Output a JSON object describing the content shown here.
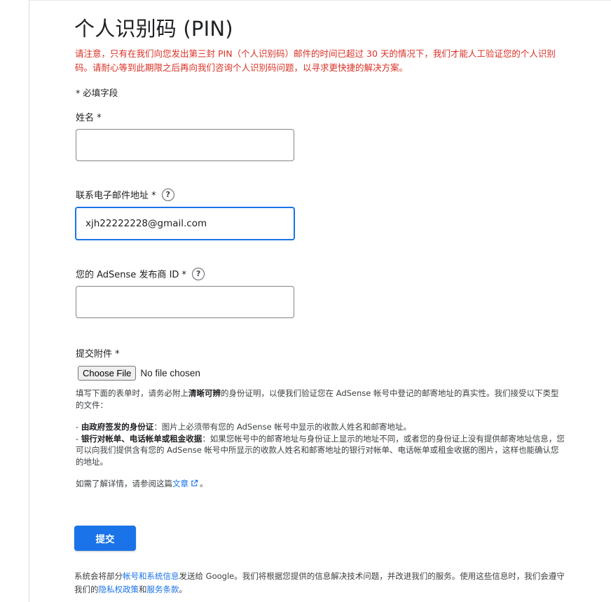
{
  "title": "个人识别码 (PIN)",
  "notice": "请注意，只有在我们向您发出第三封 PIN（个人识别码）邮件的时间已超过 30 天的情况下，我们才能人工验证您的个人识别码。请耐心等到此期限之后再向我们咨询个人识别码问题，以寻求更快捷的解决方案。",
  "required_note": "* 必填字段",
  "fields": {
    "name": {
      "label": "姓名 *",
      "value": ""
    },
    "email": {
      "label": "联系电子邮件地址 *",
      "value": "xjh22222228@gmail.com",
      "help_icon": "help-circle-icon"
    },
    "publisher_id": {
      "label": "您的 AdSense 发布商 ID *",
      "value": "",
      "help_icon": "help-circle-icon"
    },
    "attachment": {
      "label": "提交附件 *",
      "button": "Choose File",
      "status": "No file chosen"
    }
  },
  "helptext": {
    "intro_a": "填写下面的表单时，请务必附上",
    "intro_bold": "清晰可辨",
    "intro_b": "的身份证明，以便我们验证您在 AdSense 帐号中登记的邮寄地址的真实性。我们接受以下类型的文件：",
    "item1_prefix": "- ",
    "item1_bold": "由政府签发的身份证",
    "item1_text": "：图片上必须带有您的 AdSense 帐号中显示的收款人姓名和邮寄地址。",
    "item2_prefix": "- ",
    "item2_bold": "银行对帐单、电话帐单或租金收据",
    "item2_text": "：如果您帐号中的邮寄地址与身份证上显示的地址不同，或者您的身份证上没有提供邮寄地址信息，您可以向我们提供含有您的 AdSense 帐号中所显示的收款人姓名和邮寄地址的银行对帐单、电话帐单或租金收据的图片，这样也能确认您的地址。",
    "more_prefix": "如需了解详情，请参阅这篇",
    "more_link": "文章",
    "more_suffix": "。",
    "link_icon": "external-link-icon"
  },
  "submit_label": "提交",
  "footer": {
    "part1": "系统会将部分",
    "link1": "帐号和系统信息",
    "part2": "发送给 Google。我们将根据您提供的信息解决技术问题，并改进我们的服务。使用这些信息时，我们会遵守我们的",
    "link2": "隐私权政策",
    "part3": "和",
    "link3": "服务条款",
    "part4": "。"
  },
  "colors": {
    "accent": "#1a73e8",
    "warning": "#d93025"
  }
}
